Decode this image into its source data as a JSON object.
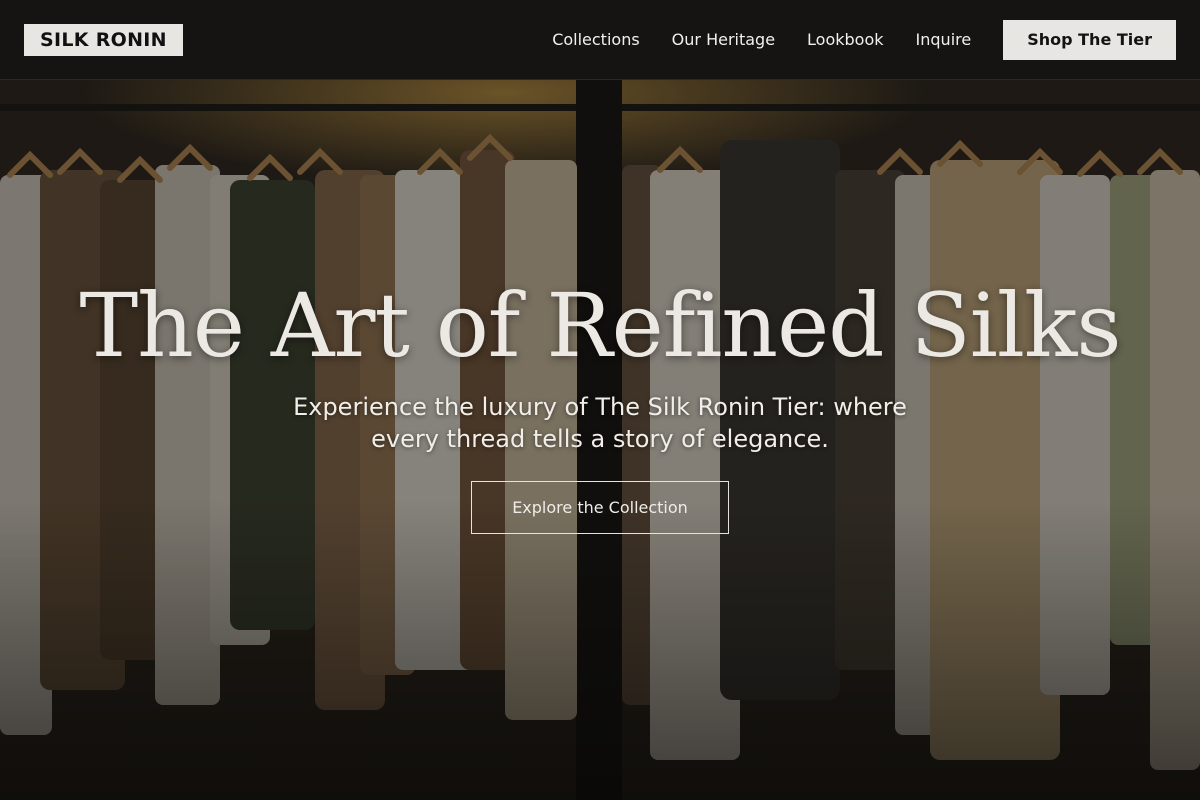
{
  "brand": {
    "logo_text": "SILK RONIN"
  },
  "nav": {
    "links": [
      "Collections",
      "Our Heritage",
      "Lookbook",
      "Inquire"
    ],
    "cta_label": "Shop The Tier"
  },
  "hero": {
    "title": "The Art of Refined Silks",
    "subtitle": "Experience the luxury of The Silk Ronin Tier: where every thread tells a story of elegance.",
    "button_label": "Explore the Collection",
    "background_image": "clothing rack with hanging garments"
  },
  "colors": {
    "navbar_bg": "#161412",
    "logo_bg": "#e8e6e3",
    "cta_bg": "#e8e6e3",
    "text_light": "#f2f0ec"
  }
}
